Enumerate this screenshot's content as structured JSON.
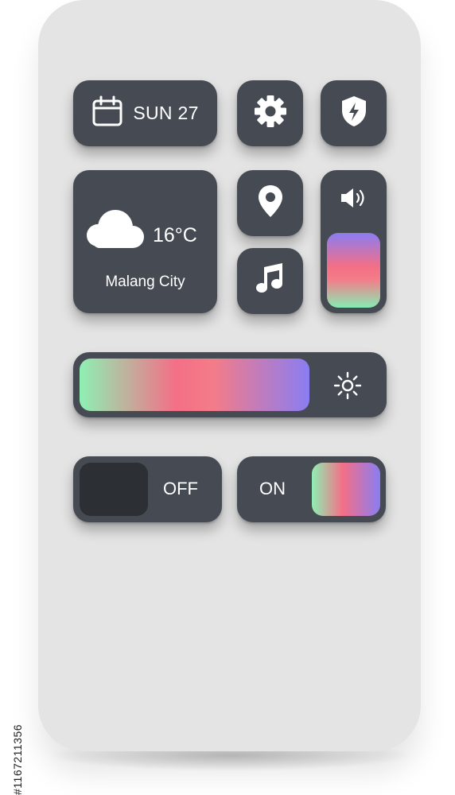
{
  "date_tile": {
    "label": "SUN 27",
    "icon": "calendar-icon"
  },
  "settings_tile": {
    "icon": "gear-icon"
  },
  "shield_tile": {
    "icon": "shield-bolt-icon"
  },
  "weather_tile": {
    "temperature": "16°C",
    "city": "Malang City",
    "icon": "cloud-icon"
  },
  "location_tile": {
    "icon": "location-pin-icon"
  },
  "music_tile": {
    "icon": "music-note-icon"
  },
  "volume_tile": {
    "icon": "speaker-icon",
    "level": 0.55
  },
  "brightness_tile": {
    "icon": "sun-icon",
    "level": 0.74
  },
  "toggle_off": {
    "label": "OFF",
    "state": "off"
  },
  "toggle_on": {
    "label": "ON",
    "state": "on"
  },
  "side_text": "#1167211356",
  "colors": {
    "tile": "#464b53",
    "background": "#e4e4e4",
    "gradient_green": "#8ef0b3",
    "gradient_pink": "#f46f86",
    "gradient_violet": "#8a7df2"
  }
}
